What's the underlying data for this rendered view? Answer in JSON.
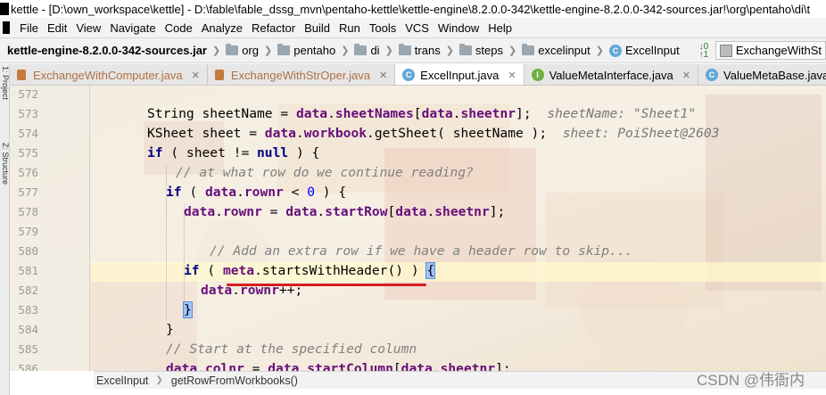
{
  "window": {
    "title": "kettle - [D:\\own_workspace\\kettle] - D:\\fable\\fable_dssg_mvn\\pentaho-kettle\\kettle-engine\\8.2.0.0-342\\kettle-engine-8.2.0.0-342-sources.jar!\\org\\pentaho\\di\\t"
  },
  "menu": [
    "File",
    "Edit",
    "View",
    "Navigate",
    "Code",
    "Analyze",
    "Refactor",
    "Build",
    "Run",
    "Tools",
    "VCS",
    "Window",
    "Help"
  ],
  "nav": {
    "root": "kettle-engine-8.2.0.0-342-sources.jar",
    "crumbs": [
      "org",
      "pentaho",
      "di",
      "trans",
      "steps",
      "excelinput"
    ],
    "class_name": "ExcelInput",
    "run_config": "ExchangeWithSt"
  },
  "tool_stripe": [
    "1: Project",
    "Z: Structure"
  ],
  "tabs": [
    {
      "label": "ExchangeWithComputer.java",
      "icon": "java-file-icon",
      "active": false
    },
    {
      "label": "ExchangeWithStrOper.java",
      "icon": "java-file-icon",
      "active": false
    },
    {
      "label": "ExcelInput.java",
      "icon": "class-icon",
      "active": true
    },
    {
      "label": "ValueMetaInterface.java",
      "icon": "interface-icon",
      "active": false
    },
    {
      "label": "ValueMetaBase.java",
      "icon": "class-icon",
      "active": false
    }
  ],
  "editor": {
    "line_numbers": [
      "572",
      "573",
      "574",
      "575",
      "576",
      "577",
      "578",
      "579",
      "580",
      "581",
      "582",
      "583",
      "584",
      "585",
      "586"
    ],
    "lines": {
      "l573_a": "String sheetName = ",
      "l573_b": "data",
      "l573_c": ".",
      "l573_d": "sheetNames",
      "l573_e": "[",
      "l573_f": "data",
      "l573_g": ".",
      "l573_h": "sheetnr",
      "l573_i": "];",
      "l573_hint": "sheetName: \"Sheet1\"",
      "l574_a": "KSheet sheet = ",
      "l574_b": "data",
      "l574_c": ".",
      "l574_d": "workbook",
      "l574_e": ".getSheet( sheetName );",
      "l574_hint": "sheet: PoiSheet@2603",
      "l575_kw": "if",
      "l575_a": " ( sheet != ",
      "l575_kw2": "null",
      "l575_b": " ) {",
      "l576_cm": "// at what row do we continue reading?",
      "l577_kw": "if",
      "l577_a": " ( ",
      "l577_b": "data",
      "l577_c": ".",
      "l577_d": "rownr",
      "l577_e": " < ",
      "l577_num": "0",
      "l577_f": " ) {",
      "l578_a": "data",
      "l578_b": ".",
      "l578_c": "rownr",
      "l578_d": " = ",
      "l578_e": "data",
      "l578_f": ".",
      "l578_g": "startRow",
      "l578_h": "[",
      "l578_i": "data",
      "l578_j": ".",
      "l578_k": "sheetnr",
      "l578_l": "];",
      "l580_cm": "// Add an extra row if we have a header row to skip...",
      "l581_kw": "if",
      "l581_a": " ( ",
      "l581_b": "meta",
      "l581_c": ".startsWithHeader() ) ",
      "l581_brace": "{",
      "l582_a": "data",
      "l582_b": ".",
      "l582_c": "rownr",
      "l582_d": "++;",
      "l583_brace": "}",
      "l584_brace": "}",
      "l585_cm": "// Start at the specified column",
      "l586_a": "data",
      "l586_b": ".",
      "l586_c": "colnr",
      "l586_d": " = ",
      "l586_e": "data",
      "l586_f": ".",
      "l586_g": "startColumn",
      "l586_h": "[",
      "l586_i": "data",
      "l586_j": ".",
      "l586_k": "sheetnr",
      "l586_l": "];"
    }
  },
  "breadcrumb": [
    "ExcelInput",
    "getRowFromWorkbooks()"
  ],
  "watermark": "CSDN @伟衙内",
  "colors": {
    "keyword": "#000080",
    "field": "#660e7a",
    "comment": "#808080",
    "underline": "#d41f1f"
  }
}
